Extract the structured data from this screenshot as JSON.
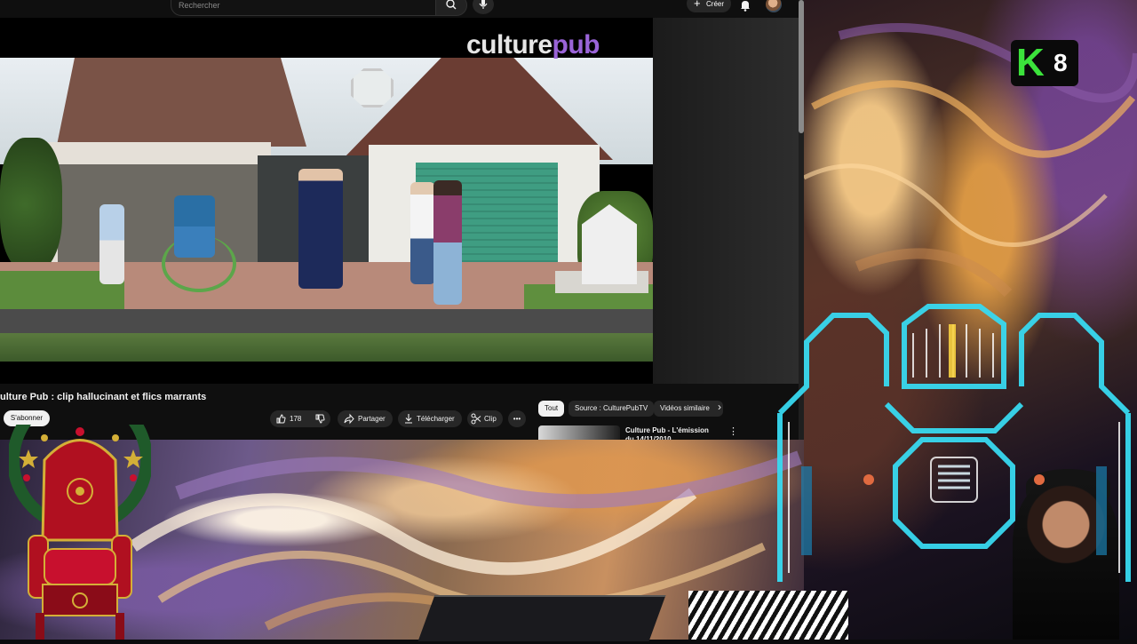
{
  "youtube": {
    "search_placeholder": "Rechercher",
    "create_label": "Créer",
    "watermark": {
      "part1": "culture",
      "part2": "pub"
    },
    "video_title": "ulture Pub : clip hallucinant et flics marrants",
    "subscribe_label": "S'abonner",
    "likes": "178",
    "share_label": "Partager",
    "download_label": "Télécharger",
    "clip_label": "Clip",
    "chips": [
      "Tout",
      "Source : CulturePubTV",
      "Vidéos similaire"
    ],
    "recommended": {
      "title": "Culture Pub - L'émission du 14/11/2010"
    }
  },
  "stream_overlay": {
    "channel_logo_letter": "K",
    "channel_logo_number": "8"
  },
  "colors": {
    "yt_bg": "#0f0f0f",
    "accent_green": "#3be23b",
    "neon_cyan": "#38d9f0"
  }
}
